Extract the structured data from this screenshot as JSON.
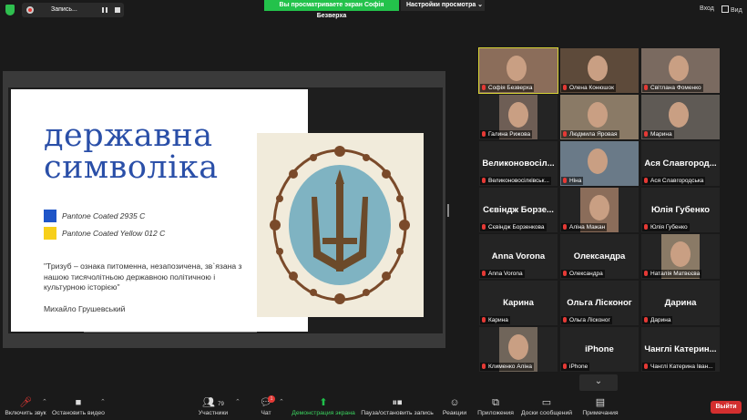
{
  "topbar": {
    "recording_label": "Запись...",
    "viewing_banner": "Вы просматриваете экран Софія Безверха",
    "view_options": "Настройки просмотра ⌄",
    "enter_label": "Вход",
    "view_label": "Вид"
  },
  "slide": {
    "title_line1": "державна",
    "title_line2": "символіка",
    "swatch1_color": "#1f55c8",
    "swatch1_label": "Pantone Coated 2935 C",
    "swatch2_color": "#f7cf1a",
    "swatch2_label": "Pantone Coated Yellow 012 C",
    "quote": "\"Тризуб – ознака питоменна, незапозичена, зв`язана з нашою тисячолітньою державною політичною і культурною історією\"",
    "author": "Михайло Грушевський"
  },
  "participants": [
    {
      "name": "",
      "label": "Софія Безверха",
      "video": true
    },
    {
      "name": "",
      "label": "Олена Конюшок",
      "video": true
    },
    {
      "name": "",
      "label": "Світлана Фоменко",
      "video": true
    },
    {
      "name": "",
      "label": "Галина Рижова",
      "video": true
    },
    {
      "name": "",
      "label": "Людмила Яровая",
      "video": true
    },
    {
      "name": "",
      "label": "Марина",
      "video": true
    },
    {
      "name": "Великоновосіл...",
      "label": "Великоновосілківськ...",
      "video": false
    },
    {
      "name": "",
      "label": "Ніна",
      "video": true
    },
    {
      "name": "Ася Славгород...",
      "label": "Ася Славгородська",
      "video": false
    },
    {
      "name": "Сєвіндж Борзе...",
      "label": "Сєвіндж Борзенкова",
      "video": false
    },
    {
      "name": "",
      "label": "Аліна Мажан",
      "video": true
    },
    {
      "name": "Юлія Губенко",
      "label": "Юлія Губенко",
      "video": false
    },
    {
      "name": "Anna Vorona",
      "label": "Anna Vorona",
      "video": false
    },
    {
      "name": "Олександра",
      "label": "Олександра",
      "video": false
    },
    {
      "name": "",
      "label": "Наталія Матвєєва",
      "video": true
    },
    {
      "name": "Карина",
      "label": "Карина",
      "video": false
    },
    {
      "name": "Ольга Лісконог",
      "label": "Ольга Лісконог",
      "video": false
    },
    {
      "name": "Дарина",
      "label": "Дарина",
      "video": false
    },
    {
      "name": "",
      "label": "Клименко Аліна",
      "video": true
    },
    {
      "name": "iPhone",
      "label": "iPhone",
      "video": false
    },
    {
      "name": "Чанглі Катерин...",
      "label": "Чанглі Катерина Іван...",
      "video": false
    }
  ],
  "toolbar": {
    "mute": "Включить звук",
    "video": "Остановить видео",
    "participants": "Участники",
    "participants_count": "79",
    "chat": "Чат",
    "chat_badge": "1",
    "share": "Демонстрация экрана",
    "record": "Пауза/остановить запись",
    "reactions": "Реакции",
    "apps": "Приложения",
    "whiteboards": "Доски сообщений",
    "notes": "Примечания",
    "leave": "Выйти"
  }
}
